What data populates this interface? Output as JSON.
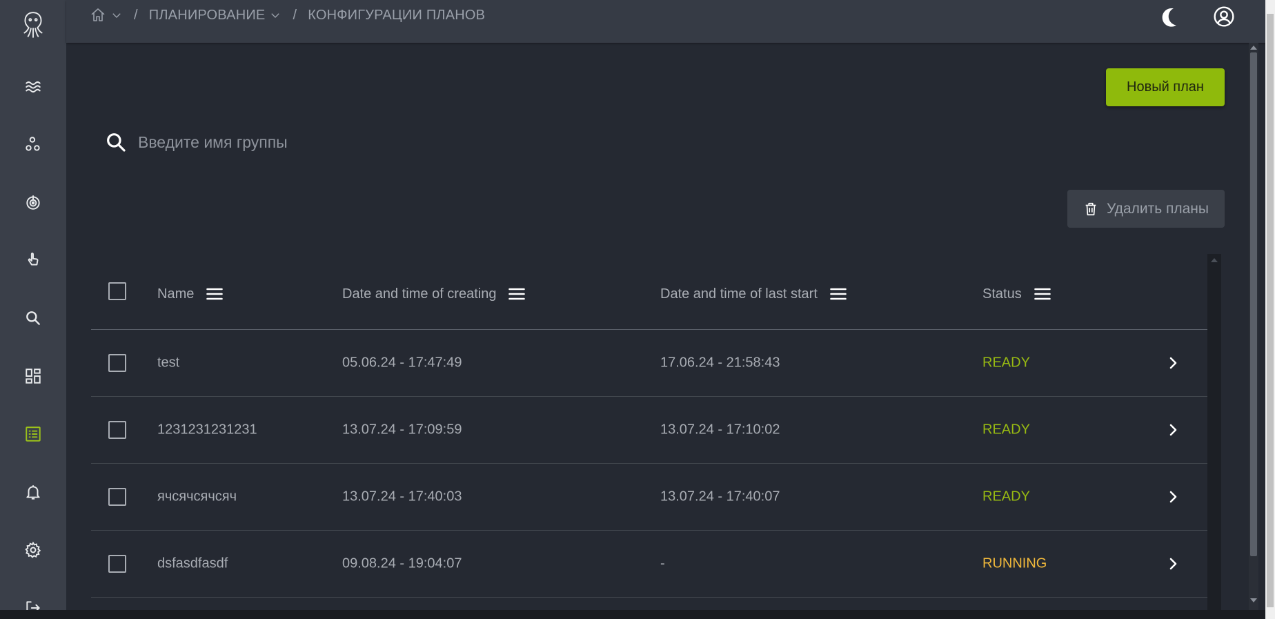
{
  "breadcrumb": {
    "home_icon": "home-icon",
    "items": [
      {
        "label": "ПЛАНИРОВАНИЕ",
        "has_dropdown": true
      },
      {
        "label": "КОНФИГУРАЦИИ ПЛАНОВ",
        "has_dropdown": false
      }
    ],
    "separator": "/"
  },
  "header": {
    "theme_icon": "moon-icon",
    "account_icon": "user-circle-icon"
  },
  "sidebar": {
    "logo": "octopus-logo-icon",
    "items": [
      {
        "icon": "waves-icon",
        "active": false
      },
      {
        "icon": "cluster-icon",
        "active": false
      },
      {
        "icon": "target-icon",
        "active": false
      },
      {
        "icon": "pointer-hand-icon",
        "active": false
      },
      {
        "icon": "search-icon",
        "active": false
      },
      {
        "icon": "dashboard-icon",
        "active": false
      },
      {
        "icon": "list-icon",
        "active": true
      },
      {
        "icon": "bell-icon",
        "active": false
      },
      {
        "icon": "gear-icon",
        "active": false
      },
      {
        "icon": "logout-icon",
        "active": false
      }
    ]
  },
  "toolbar": {
    "new_plan_label": "Новый план",
    "delete_plans_label": "Удалить планы"
  },
  "search": {
    "placeholder": "Введите имя группы",
    "value": ""
  },
  "table": {
    "columns": [
      {
        "label": "Name"
      },
      {
        "label": "Date and time of creating"
      },
      {
        "label": "Date and time of last start"
      },
      {
        "label": "Status"
      }
    ],
    "rows": [
      {
        "name": "test",
        "created": "05.06.24 - 17:47:49",
        "last_start": "17.06.24 - 21:58:43",
        "status": "READY"
      },
      {
        "name": "1231231231231",
        "created": "13.07.24 - 17:09:59",
        "last_start": "13.07.24 - 17:10:02",
        "status": "READY"
      },
      {
        "name": "ячсячсячсяч",
        "created": "13.07.24 - 17:40:03",
        "last_start": "13.07.24 - 17:40:07",
        "status": "READY"
      },
      {
        "name": "dsfasdfasdf",
        "created": "09.08.24 - 19:04:07",
        "last_start": "-",
        "status": "RUNNING"
      }
    ]
  },
  "colors": {
    "accent": "#8fba0c",
    "ready": "#98ba12",
    "running": "#f1b93b",
    "sidebar_bg": "#3a3f49",
    "content_bg": "#252932"
  }
}
